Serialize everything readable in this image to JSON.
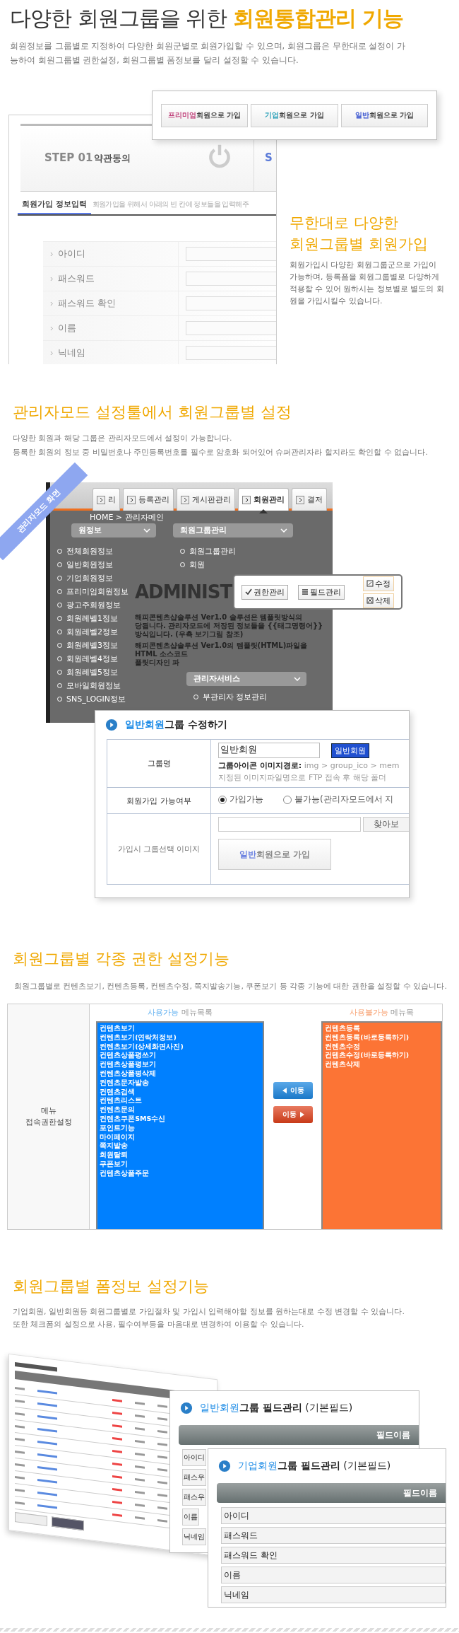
{
  "hero": {
    "title": "다양한 회원그룹을 위한",
    "title_highlight": "회원통합관리 기능",
    "description": "회원정보를 그룹별로 지정하여 다양한 회원군별로 회원가입할 수 있으며, 회원그룹은 무한대로 설정이 가능하여 회원그룹별 권한설정, 회원그룹별 폼정보를 달리 설정할 수 있습니다."
  },
  "signup": {
    "join_buttons": [
      {
        "accent": "프리미엄",
        "label": "회원으로 가입",
        "color": "#c0407a"
      },
      {
        "accent": "기업",
        "label": "회원으로 가입",
        "color": "#2aa0b8"
      },
      {
        "accent": "일반",
        "label": "회원으로 가입",
        "color": "#3a55d0"
      }
    ],
    "step": {
      "number": "STEP 01",
      "title": "약관동의",
      "next": "S"
    },
    "form_tab": "회원가입 정보입력",
    "form_hint": "회원가입을 위해서 아래의 빈 칸에 정보들을 입력해주",
    "fields": [
      "아이디",
      "패스워드",
      "패스워드 확인",
      "이름",
      "닉네임"
    ],
    "heading_lines": [
      "무한대로 다양한",
      "회원그룹별 회원가입"
    ],
    "text": "회원가입시 다양한 회원그룹군으로 가입이 가능하며, 등록폼을 회원그룹별로 다양하게 적용할 수 있어 원하시는 정보별로 별도의 회원을 가입시킬수 있습니다."
  },
  "admin": {
    "heading": "관리자모드 설정툴에서 회원그룹별 설정",
    "description_lines": [
      "다양한 회원과 해당 그룹은 관리자모드에서 설정이 가능합니다.",
      "등록한 회원의 정보 중 비밀번호나 주민등록번호를 필수로 암호화 되어있어 슈퍼관리자라 할지라도 확인할 수 없습니다."
    ],
    "ribbon": "관리자모드 화면",
    "tabs": [
      {
        "label": "리",
        "selected": false
      },
      {
        "label": "등록관리",
        "selected": false
      },
      {
        "label": "게시판관리",
        "selected": false
      },
      {
        "label": "회원관리",
        "selected": true
      },
      {
        "label": "결저",
        "selected": false
      }
    ],
    "breadcrumb": "HOME > 관리자메인",
    "panels": [
      {
        "title": "원정보",
        "items": [
          "전체회원정보",
          "일반회원정보",
          "기업회원정보",
          "프리미엄회원정보",
          "광고주회원정보",
          "회원레벨1정보",
          "회원레벨2정보",
          "회원레벨3정보",
          "회원레벨4정보",
          "회원레벨5정보",
          "모바일회원정보",
          "SNS_LOGIN정보"
        ]
      },
      {
        "title": "회원그룹관리",
        "items": [
          "회원그룹관리",
          "회원"
        ]
      }
    ],
    "banner": "ADMINIST",
    "notes": [
      [
        "해피콘텐츠샵솔루션 Ver1.0 솔루션은 템플릿방식의",
        "당됩니다. 관리자모드에 저장된 정보들을 {{태그명령어}}",
        "방식입니다. (우측 보기그림 참조)"
      ],
      [
        "해피콘텐츠샵솔루션 Ver1.0의 템플릿(HTML)파일을",
        "HTML 소스코드",
        "플릿디자인 파"
      ]
    ],
    "service_menu": {
      "title": "관리자서비스",
      "items": [
        "부관리자 정보관리"
      ]
    },
    "popup": {
      "buttons": [
        {
          "kind": "check",
          "label": "권한관리"
        },
        {
          "kind": "list",
          "label": "필드관리"
        }
      ],
      "actions": [
        {
          "kind": "edit",
          "label": "수정"
        },
        {
          "kind": "delete",
          "label": "삭제"
        }
      ]
    },
    "dialog": {
      "title_accent": "일반회원",
      "title": "그룹 수정하기",
      "group_name": {
        "label": "그룹명",
        "value": "일반회원",
        "badge": "일반회원",
        "path_label": "그룹아이콘 이미지경로:",
        "path": "img > group_ico > mem",
        "note": "지정된 이미지파일명으로 FTP 접속 후 해당 폴더"
      },
      "join_allowed": {
        "label": "회원가입 가능여부",
        "options": [
          {
            "label": "가입가능",
            "selected": true
          },
          {
            "label": "불가능(관리자모드에서 지",
            "selected": false
          }
        ]
      },
      "join_image": {
        "label": "가입시 그룹선택 이미지",
        "browse": "찾아보",
        "preview_accent": "일반",
        "preview": "회원으로 가입"
      }
    }
  },
  "permissions": {
    "heading": "회원그룹별 각종 권한 설정기능",
    "description": "회원그룹별로 컨텐츠보기, 컨텐츠등록, 컨텐츠수정, 쪽지발송기능, 쿠폰보기 등 각종 기능에 대한 권한을 설정할 수 있습니다.",
    "row_label_lines": [
      "메뉴",
      "접속권한설정"
    ],
    "available": {
      "accent": "사용가능",
      "title": "메뉴목록",
      "items": [
        "컨텐츠보기",
        "컨텐츠보기(연락처정보)",
        "컨텐츠보기(상세화면사진)",
        "컨텐츠상품평쓰기",
        "컨텐츠상품평보기",
        "컨텐츠상품평삭제",
        "컨텐츠문자발송",
        "컨텐츠검색",
        "컨텐츠리스트",
        "컨텐츠문의",
        "컨텐츠쿠폰SMS수신",
        "포인트기능",
        "마이페이지",
        "쪽지발송",
        "회원탈퇴",
        "쿠폰보기",
        "컨텐츠상품주문"
      ]
    },
    "unavailable": {
      "accent": "사용불가능",
      "title": "메뉴목",
      "items": [
        "컨텐츠등록",
        "컨텐츠등록(바로등록하기)",
        "컨텐츠수정",
        "컨텐츠수정(바로등록하기)",
        "컨텐츠삭제"
      ]
    },
    "move_buttons": [
      {
        "kind": "left",
        "label": "이동"
      },
      {
        "kind": "right",
        "label": "이동"
      }
    ]
  },
  "forms": {
    "heading": "회원그룹별 폼정보 설정기능",
    "description_lines": [
      "기업회원, 일반회원등 회원그룹별로 가입절차 및 가입시 입력해야할 정보를 원하는대로 수정 변경할 수 있습니다.",
      "또한 체크폼의 설정으로 사용, 필수여부등을 마음대로 변경하여 이용할 수 있습니다."
    ],
    "dialogs": [
      {
        "accent": "일반회원",
        "title": "그룹 필드관리",
        "suffix": "(기본필드)",
        "column": "필드이름",
        "rows": [
          "아이디",
          "패스우",
          "패스우",
          "이름",
          "닉네임"
        ]
      },
      {
        "accent": "기업회원",
        "title": "그룹 필드관리",
        "suffix": "(기본필드)",
        "column": "필드이름",
        "rows": [
          "아이디",
          "패스워드",
          "패스워드 확인",
          "이름",
          "닉네임"
        ]
      }
    ]
  }
}
